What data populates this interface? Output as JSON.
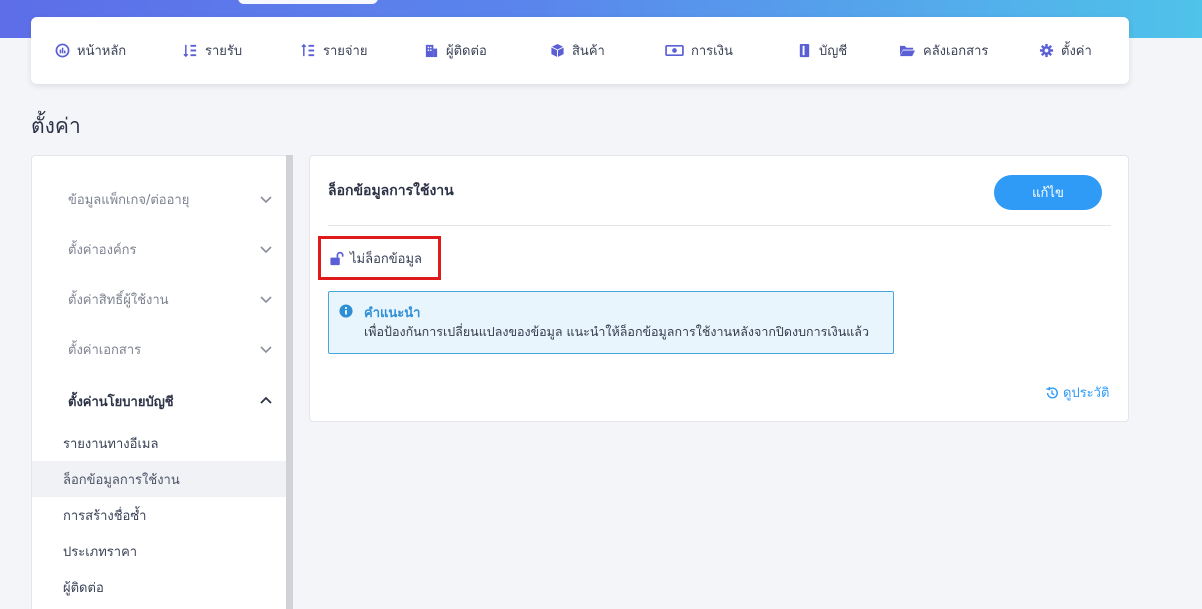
{
  "colors": {
    "accent": "#2f9bf7",
    "nav_icon": "#5b5fd6",
    "highlight_border": "#e01a1a",
    "info_bg": "#e9f5fd",
    "info_border": "#49a6dd"
  },
  "nav": {
    "items": [
      {
        "label": "หน้าหลัก",
        "icon": "dashboard-icon"
      },
      {
        "label": "รายรับ",
        "icon": "income-icon"
      },
      {
        "label": "รายจ่าย",
        "icon": "expense-icon"
      },
      {
        "label": "ผู้ติดต่อ",
        "icon": "contacts-icon"
      },
      {
        "label": "สินค้า",
        "icon": "box-icon"
      },
      {
        "label": "การเงิน",
        "icon": "money-icon"
      },
      {
        "label": "บัญชี",
        "icon": "book-icon"
      },
      {
        "label": "คลังเอกสาร",
        "icon": "folder-icon"
      },
      {
        "label": "ตั้งค่า",
        "icon": "gear-icon"
      }
    ]
  },
  "page": {
    "title": "ตั้งค่า"
  },
  "sidebar": {
    "groups": [
      {
        "label": "ข้อมูลแพ็กเกจ/ต่ออายุ",
        "expanded": false
      },
      {
        "label": "ตั้งค่าองค์กร",
        "expanded": false
      },
      {
        "label": "ตั้งค่าสิทธิ์ผู้ใช้งาน",
        "expanded": false
      },
      {
        "label": "ตั้งค่าเอกสาร",
        "expanded": false
      },
      {
        "label": "ตั้งค่านโยบายบัญชี",
        "expanded": true
      }
    ],
    "sub_items": [
      {
        "label": "รายงานทางอีเมล",
        "selected": false
      },
      {
        "label": "ล็อกข้อมูลการใช้งาน",
        "selected": true
      },
      {
        "label": "การสร้างชื่อซ้ำ",
        "selected": false
      },
      {
        "label": "ประเภทราคา",
        "selected": false
      },
      {
        "label": "ผู้ติดต่อ",
        "selected": false
      }
    ]
  },
  "main": {
    "title": "ล็อกข้อมูลการใช้งาน",
    "edit_label": "แก้ไข",
    "lock_status": "ไม่ล็อกข้อมูล",
    "info_title": "คำแนะนำ",
    "info_text": "เพื่อป้องกันการเปลี่ยนแปลงของข้อมูล แนะนำให้ล็อกข้อมูลการใช้งานหลังจากปิดงบการเงินแล้ว",
    "history_label": "ดูประวัติ"
  }
}
